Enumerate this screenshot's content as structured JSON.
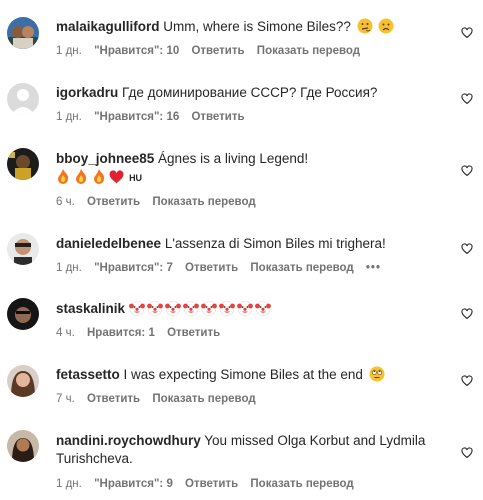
{
  "comments": [
    {
      "username": "malaikagulliford",
      "text": "Umm, where is Simone Biles??",
      "time": "1 дн.",
      "likes": "\"Нравится\": 10",
      "reply": "Ответить",
      "translate": "Показать перевод"
    },
    {
      "username": "igorkadru",
      "text": "Где доминирование СССР? Где Россия?",
      "time": "1 дн.",
      "likes": "\"Нравится\": 16",
      "reply": "Ответить"
    },
    {
      "username": "bboy_johnee85",
      "text": "Ágnes is a living Legend!",
      "flag_text": "HU",
      "time": "6 ч.",
      "reply": "Ответить",
      "translate": "Показать перевод"
    },
    {
      "username": "danieledelbenee",
      "text": "L'assenza di Simon Biles mi trighera!",
      "time": "1 дн.",
      "likes": "\"Нравится\": 7",
      "reply": "Ответить",
      "translate": "Показать перевод",
      "more": "•••"
    },
    {
      "username": "staskalinik",
      "time": "4 ч.",
      "likes": "Нравится: 1",
      "reply": "Ответить"
    },
    {
      "username": "fetassetto",
      "text": "I was expecting Simone Biles at the end",
      "time": "7 ч.",
      "reply": "Ответить",
      "translate": "Показать перевод"
    },
    {
      "username": "nandini.roychowdhury",
      "text": "You missed Olga Korbut and Lydmila",
      "text2": "Turishcheva.",
      "time": "1 дн.",
      "likes": "\"Нравится\": 9",
      "reply": "Ответить",
      "translate": "Показать перевод"
    }
  ],
  "icons": {
    "like": "heart-outline-icon"
  },
  "colors": {
    "text": "#262626",
    "meta": "#737373"
  }
}
